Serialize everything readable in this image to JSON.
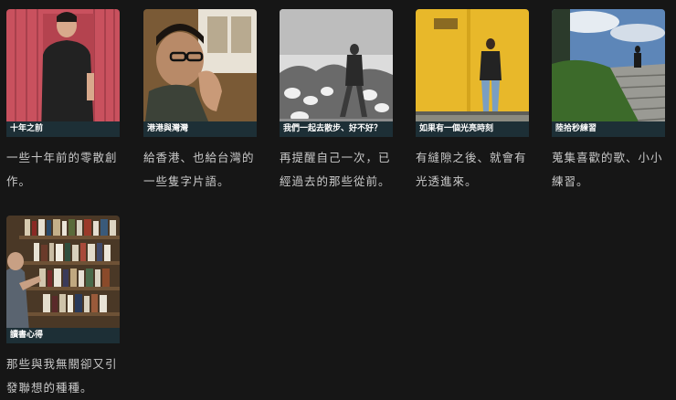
{
  "colors": {
    "background": "#161616",
    "caption_bg": "#1d2f36",
    "text": "#c9c9c9"
  },
  "albums": [
    {
      "title": "十年之前",
      "description": "一些十年前的零散創作。"
    },
    {
      "title": "港港與灣灣",
      "description": "給香港、也給台灣的一些隻字片語。"
    },
    {
      "title": "我們一起去散步、好不好？",
      "description": "再提醒自己一次，已經過去的那些從前。"
    },
    {
      "title": "如果有一個光亮時刻",
      "description": "有縫隙之後、就會有光透進來。"
    },
    {
      "title": "陸拾秒練習",
      "description": "蒐集喜歡的歌、小小練習。"
    },
    {
      "title": "讀書心得",
      "description": "那些與我無關卻又引發聯想的種種。"
    }
  ]
}
